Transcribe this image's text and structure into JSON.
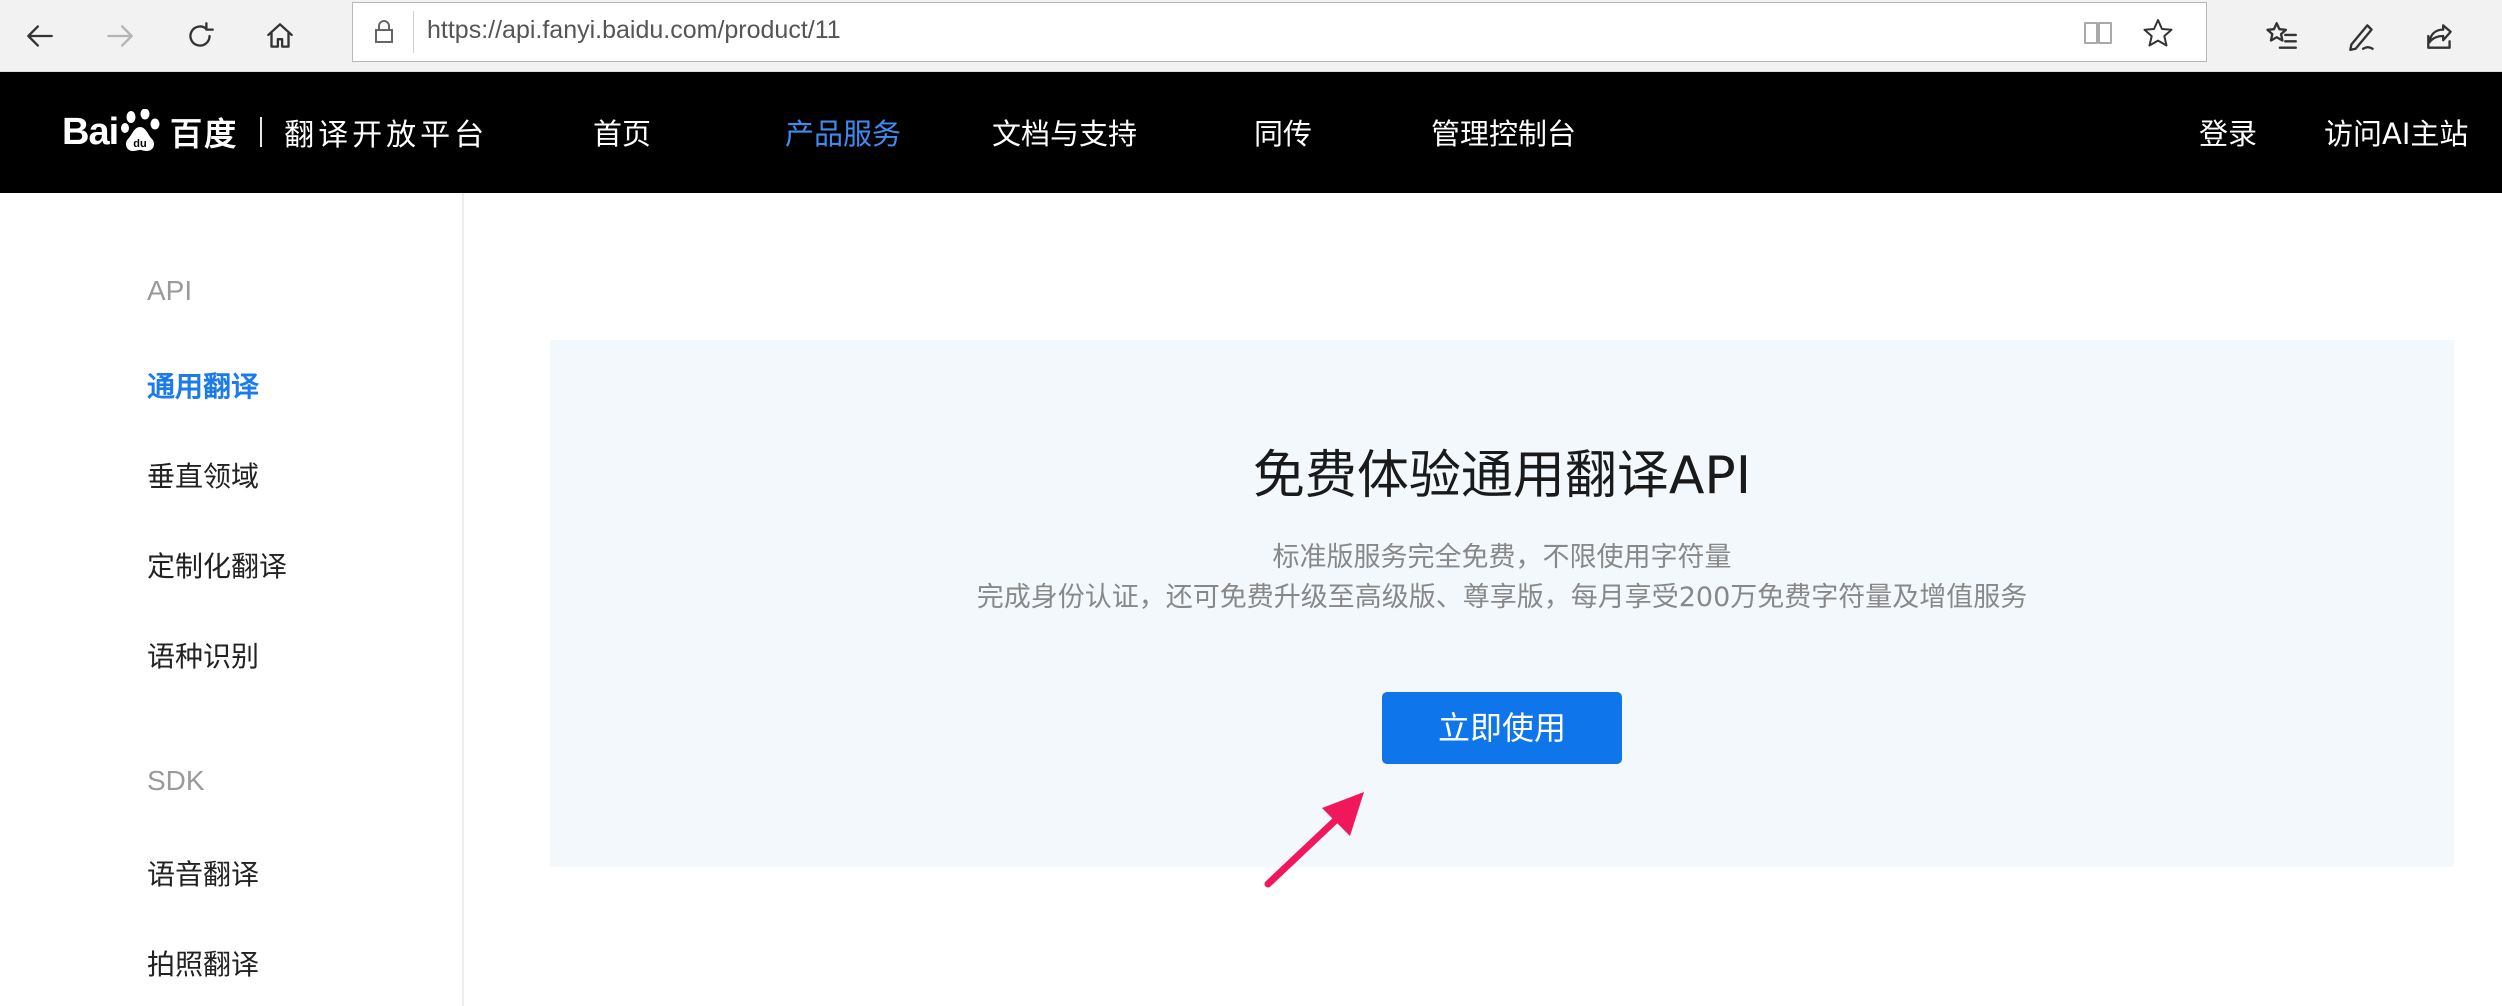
{
  "browser": {
    "url": "https://api.fanyi.baidu.com/product/11",
    "icons": [
      "back-arrow-icon",
      "forward-arrow-icon",
      "refresh-icon",
      "home-icon",
      "lock-icon",
      "reading-view-icon",
      "favorite-star-icon",
      "favorites-list-icon",
      "pen-icon",
      "share-icon"
    ]
  },
  "header": {
    "brand_bai": "Bai",
    "brand_du": "du",
    "brand_cn": "百度",
    "brand_sub": "翻译开放平台",
    "nav": [
      "首页",
      "产品服务",
      "文档与支持",
      "同传",
      "管理控制台"
    ],
    "active_nav": "产品服务",
    "login": "登录",
    "ai_site": "访问AI主站"
  },
  "sidebar": {
    "api_heading": "API",
    "api_items": [
      "通用翻译",
      "垂直领域",
      "定制化翻译",
      "语种识别"
    ],
    "active_item": "通用翻译",
    "sdk_heading": "SDK",
    "sdk_items": [
      "语音翻译",
      "拍照翻译"
    ]
  },
  "promo": {
    "title": "免费体验通用翻译API",
    "line1": "标准版服务完全免费，不限使用字符量",
    "line2": "完成身份认证，还可免费升级至高级版、尊享版，每月享受200万免费字符量及增值服务",
    "cta": "立即使用"
  },
  "colors": {
    "header_bg": "#000000",
    "active_nav": "#3e8bf2",
    "sidebar_active": "#1b7bea",
    "promo_bg": "#f3f8fd",
    "cta_bg": "#0f75ea",
    "annotation_arrow": "#f0185a"
  }
}
